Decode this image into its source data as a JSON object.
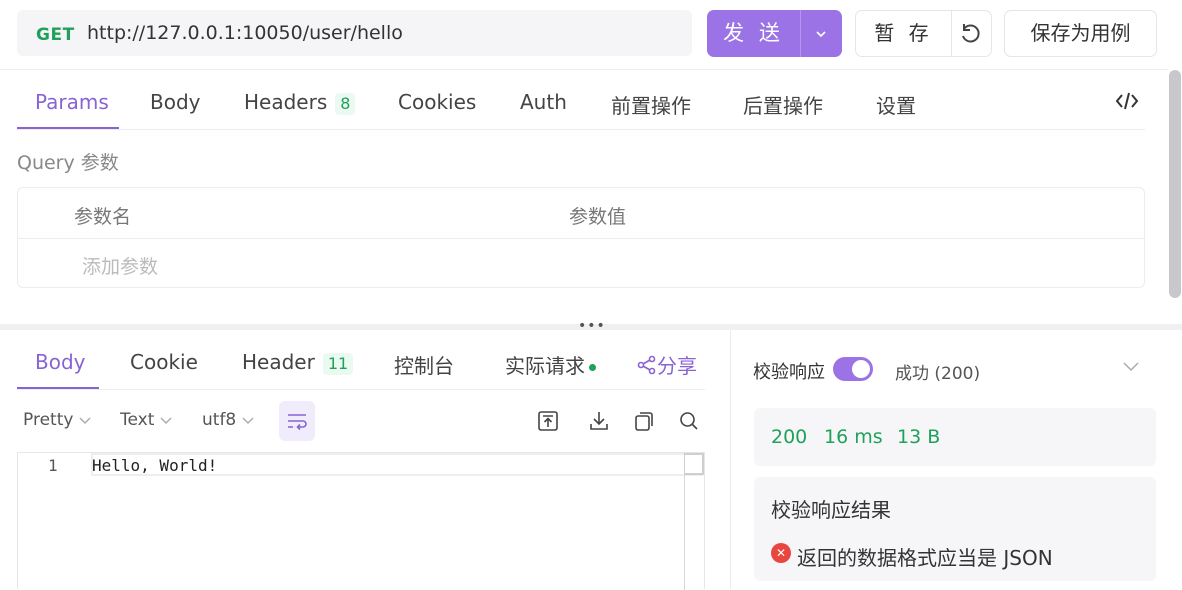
{
  "request": {
    "method": "GET",
    "url": "http://127.0.0.1:10050/user/hello",
    "send_label": "发 送",
    "save_label": "暂 存",
    "save_case_label": "保存为用例"
  },
  "request_tabs": [
    {
      "label": "Params",
      "active": true
    },
    {
      "label": "Body"
    },
    {
      "label": "Headers",
      "badge": "8"
    },
    {
      "label": "Cookies"
    },
    {
      "label": "Auth"
    },
    {
      "label": "前置操作"
    },
    {
      "label": "后置操作"
    },
    {
      "label": "设置"
    }
  ],
  "params": {
    "section_label": "Query 参数",
    "col_name": "参数名",
    "col_value": "参数值",
    "add_placeholder": "添加参数"
  },
  "response_tabs": [
    {
      "label": "Body",
      "active": true
    },
    {
      "label": "Cookie"
    },
    {
      "label": "Header",
      "badge": "11"
    },
    {
      "label": "控制台"
    },
    {
      "label": "实际请求",
      "dot": true
    },
    {
      "label": "分享"
    }
  ],
  "response_toolbar": {
    "format": "Pretty",
    "type": "Text",
    "encoding": "utf8"
  },
  "editor": {
    "line_number": "1",
    "content": "Hello, World!"
  },
  "validation": {
    "label": "校验响应",
    "enabled": true,
    "status": "成功 (200)",
    "status_code": "200",
    "time": "16 ms",
    "size": "13 B",
    "result_title": "校验响应结果",
    "error_message": "返回的数据格式应当是 JSON"
  },
  "colors": {
    "accent": "#9b73e6",
    "success": "#20a15b",
    "error": "#e8463e"
  }
}
